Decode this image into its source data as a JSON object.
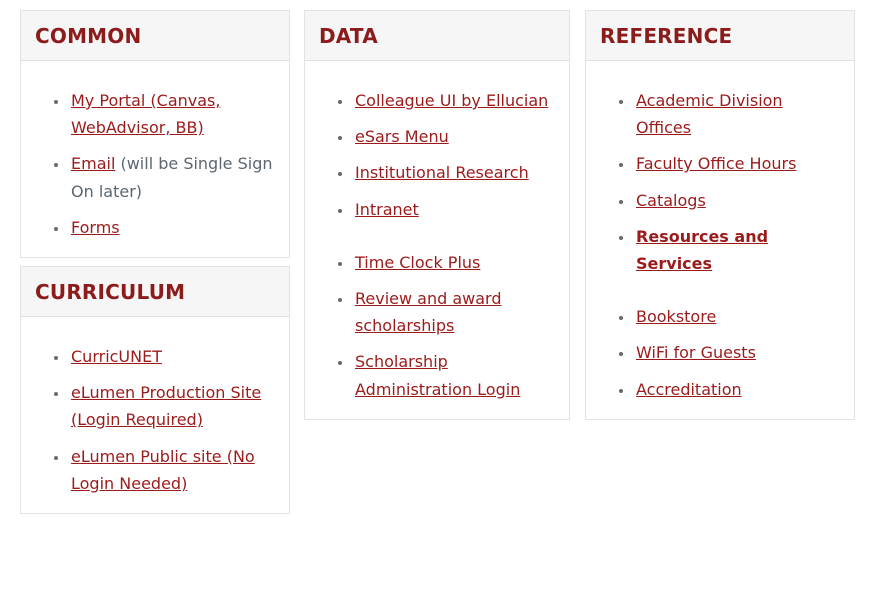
{
  "page": {
    "background_color": "#ffffff",
    "link_color": "#9b1b1b",
    "heading_color": "#8c1b1b",
    "text_color": "#5b6770",
    "panel_border_color": "#e2e2e2",
    "panel_header_background": "#f6f6f6"
  },
  "columns": [
    {
      "id": "column-left",
      "panels": [
        {
          "id": "panel-common",
          "title": "COMMON",
          "groups": [
            {
              "items": [
                {
                  "link": "My Portal (Canvas, WebAdvisor, BB)",
                  "note": "",
                  "emphasis": false
                },
                {
                  "link": "Email",
                  "note": " (will be Single Sign On later)",
                  "emphasis": false
                },
                {
                  "link": "Forms",
                  "note": "",
                  "emphasis": false
                }
              ]
            }
          ]
        },
        {
          "id": "panel-curriculum",
          "title": "CURRICULUM",
          "groups": [
            {
              "items": [
                {
                  "link": "CurricUNET",
                  "note": "",
                  "emphasis": false
                },
                {
                  "link": "eLumen Production Site (Login Required)",
                  "note": "",
                  "emphasis": false
                },
                {
                  "link": "eLumen Public site (No Login Needed)",
                  "note": "",
                  "emphasis": false
                }
              ]
            }
          ]
        }
      ]
    },
    {
      "id": "column-middle",
      "panels": [
        {
          "id": "panel-data",
          "title": "DATA",
          "groups": [
            {
              "items": [
                {
                  "link": "Colleague UI by Ellucian",
                  "note": "",
                  "emphasis": false
                },
                {
                  "link": "eSars Menu",
                  "note": "",
                  "emphasis": false
                },
                {
                  "link": "Institutional Research",
                  "note": "",
                  "emphasis": false
                },
                {
                  "link": "Intranet",
                  "note": "",
                  "emphasis": false
                }
              ]
            },
            {
              "items": [
                {
                  "link": "Time Clock Plus",
                  "note": "",
                  "emphasis": false
                },
                {
                  "link": "Review and award scholarships",
                  "note": "",
                  "emphasis": false
                },
                {
                  "link": "Scholarship Administration Login",
                  "note": "",
                  "emphasis": false
                }
              ]
            }
          ]
        }
      ]
    },
    {
      "id": "column-right",
      "panels": [
        {
          "id": "panel-reference",
          "title": "REFERENCE",
          "groups": [
            {
              "items": [
                {
                  "link": "Academic Division Offices",
                  "note": "",
                  "emphasis": false
                },
                {
                  "link": "Faculty Office Hours",
                  "note": "",
                  "emphasis": false
                },
                {
                  "link": "Catalogs",
                  "note": "",
                  "emphasis": false
                },
                {
                  "link": "Resources and Services",
                  "note": "",
                  "emphasis": true
                }
              ]
            },
            {
              "items": [
                {
                  "link": "Bookstore",
                  "note": "",
                  "emphasis": false
                },
                {
                  "link": "WiFi for Guests",
                  "note": "",
                  "emphasis": false
                },
                {
                  "link": "Accreditation",
                  "note": "",
                  "emphasis": false
                }
              ]
            }
          ]
        }
      ]
    }
  ]
}
